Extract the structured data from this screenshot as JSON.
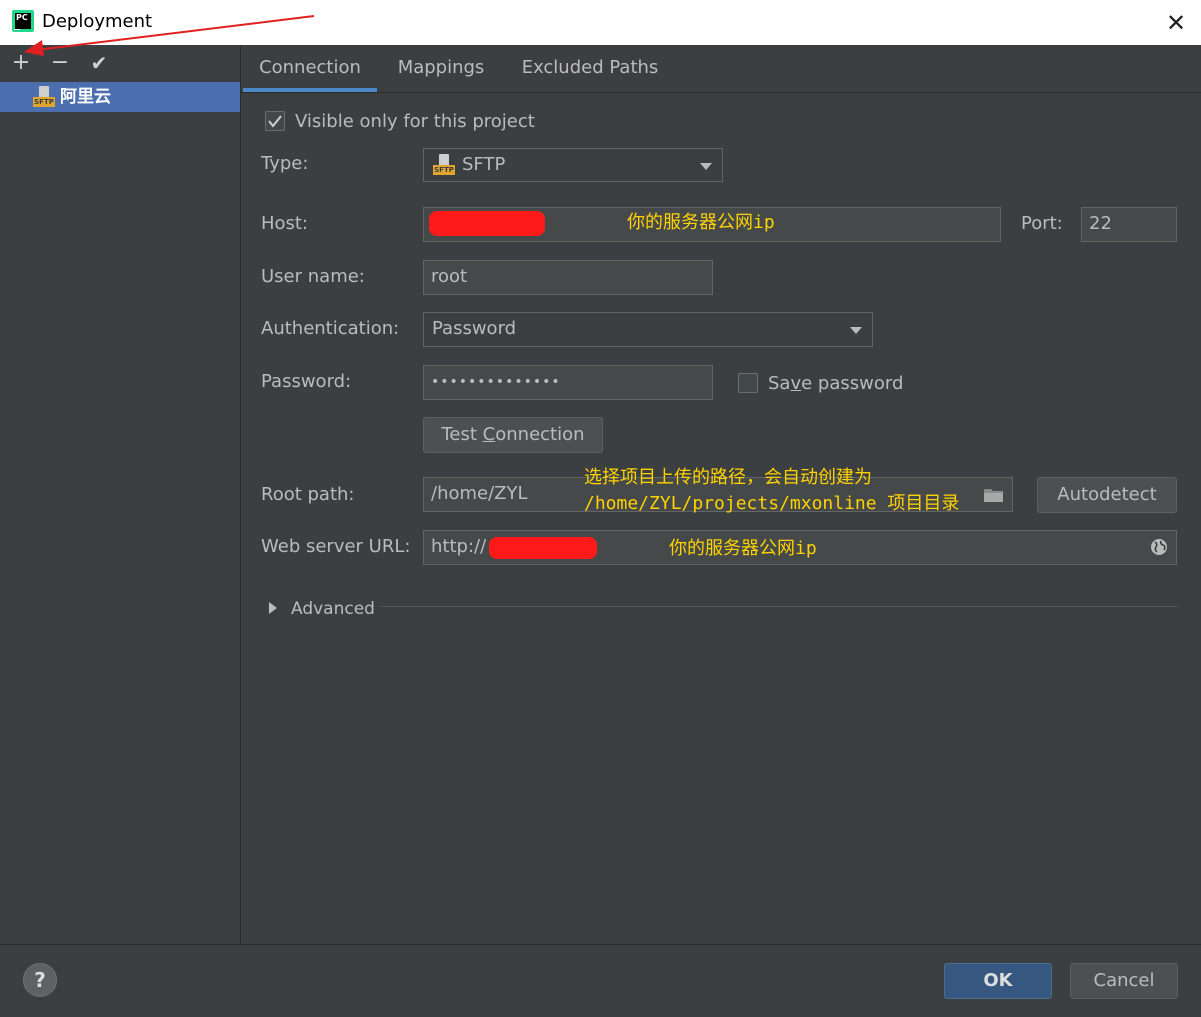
{
  "window": {
    "title": "Deployment",
    "app_icon_text": "PC"
  },
  "toolbar": {
    "add": "+",
    "remove": "−",
    "apply": "✔"
  },
  "sidebar": {
    "items": [
      {
        "label": "阿里云",
        "icon": "sftp-icon",
        "icon_text": "SFTP"
      }
    ]
  },
  "tabs": [
    {
      "label": "Connection",
      "active": true
    },
    {
      "label": "Mappings"
    },
    {
      "label": "Excluded Paths"
    }
  ],
  "form": {
    "visible_only": {
      "label": "Visible only for this project",
      "checked": true
    },
    "type": {
      "label": "Type:",
      "value": "SFTP",
      "icon_text": "SFTP"
    },
    "host": {
      "label": "Host:",
      "value": "",
      "annotation": "你的服务器公网ip"
    },
    "port": {
      "label": "Port:",
      "value": "22"
    },
    "username": {
      "label": "User name:",
      "value": "root"
    },
    "auth": {
      "label": "Authentication:",
      "value": "Password"
    },
    "password": {
      "label": "Password:",
      "value": "••••••••••••••"
    },
    "save_password": {
      "label_pre": "Sa",
      "label_mnem": "v",
      "label_post": "e password",
      "checked": false
    },
    "test_connection": {
      "label_pre": "Test ",
      "label_mnem": "C",
      "label_post": "onnection"
    },
    "root_path": {
      "label": "Root path:",
      "value": "/home/ZYL",
      "annotation_line1": "选择项目上传的路径，会自动创建为",
      "annotation_line2": "/home/ZYL/projects/mxonline 项目目录"
    },
    "autodetect": {
      "label": "Autodetect"
    },
    "web_url": {
      "label": "Web server URL:",
      "value": "http://",
      "annotation": "你的服务器公网ip"
    },
    "advanced": {
      "label": "Advanced"
    }
  },
  "footer": {
    "help": "?",
    "ok": "OK",
    "cancel": "Cancel"
  },
  "colors": {
    "accent": "#4b6eaf",
    "annotation": "#ffd200",
    "redaction": "#ff1a1a",
    "arrow": "#e02020"
  }
}
